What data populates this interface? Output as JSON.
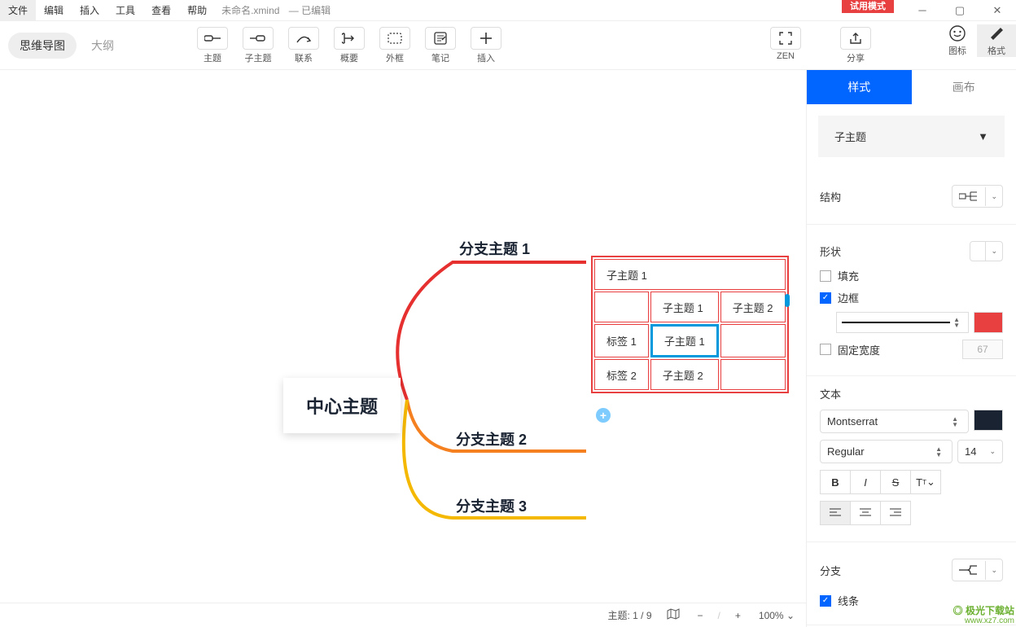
{
  "menu": {
    "file": "文件",
    "edit": "编辑",
    "insert": "插入",
    "tools": "工具",
    "view": "查看",
    "help": "帮助"
  },
  "doc": {
    "title": "未命名.xmind",
    "state": "— 已编辑"
  },
  "trial": "试用模式",
  "view_tabs": {
    "mindmap": "思维导图",
    "outline": "大纲"
  },
  "tools": {
    "topic": "主题",
    "subtopic": "子主题",
    "relation": "联系",
    "summary": "概要",
    "boundary": "外框",
    "note": "笔记",
    "insert": "插入",
    "zen": "ZEN",
    "share": "分享",
    "marker": "图标",
    "format": "格式"
  },
  "canvas": {
    "center": "中心主题",
    "branch1": "分支主题 1",
    "branch2": "分支主题 2",
    "branch3": "分支主题 3",
    "sub1": "子主题 1",
    "col1": "子主题 1",
    "col2": "子主题 2",
    "row1": "标签 1",
    "row2": "标签 2",
    "c11": "子主题 1",
    "c21": "子主题 2"
  },
  "side": {
    "tab_style": "样式",
    "tab_canvas": "画布",
    "topic_type": "子主题",
    "structure": "结构",
    "shape": "形状",
    "fill": "填充",
    "border": "边框",
    "fixed_width": "固定宽度",
    "fixed_width_val": "67",
    "text": "文本",
    "font": "Montserrat",
    "weight": "Regular",
    "size": "14",
    "branch": "分支",
    "line": "线条"
  },
  "status": {
    "topic": "主题:",
    "pos": "1 / 9",
    "zoom": "100%"
  }
}
